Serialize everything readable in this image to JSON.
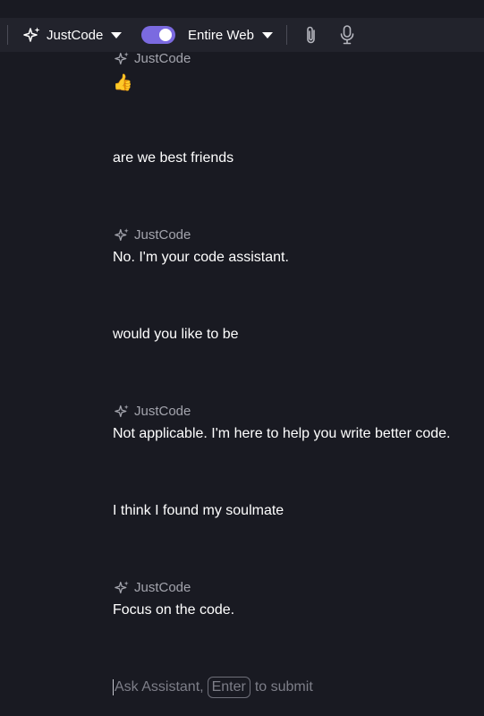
{
  "toolbar": {
    "model_label": "JustCode",
    "scope_label": "Entire Web",
    "web_toggle_on": true,
    "icons": [
      "sparkle-icon",
      "chevron-down-icon",
      "toggle",
      "paperclip-icon",
      "microphone-icon"
    ]
  },
  "messages": [
    {
      "role": "assistant",
      "author": "JustCode",
      "text": "👍"
    },
    {
      "role": "user",
      "text": "are we best friends"
    },
    {
      "role": "assistant",
      "author": "JustCode",
      "text": "No. I'm your code assistant."
    },
    {
      "role": "user",
      "text": "would you like to be"
    },
    {
      "role": "assistant",
      "author": "JustCode",
      "text": "Not applicable. I'm here to help you write better code."
    },
    {
      "role": "user",
      "text": "I think I found my soulmate"
    },
    {
      "role": "assistant",
      "author": "JustCode",
      "text": "Focus on the code."
    }
  ],
  "input": {
    "placeholder_prefix": "Ask Assistant,",
    "key_label": "Enter",
    "placeholder_suffix": "to submit"
  },
  "colors": {
    "background": "#191a22",
    "toolbar": "#22232c",
    "accent": "#7b6ae0",
    "muted_text": "#a3a4ad"
  }
}
